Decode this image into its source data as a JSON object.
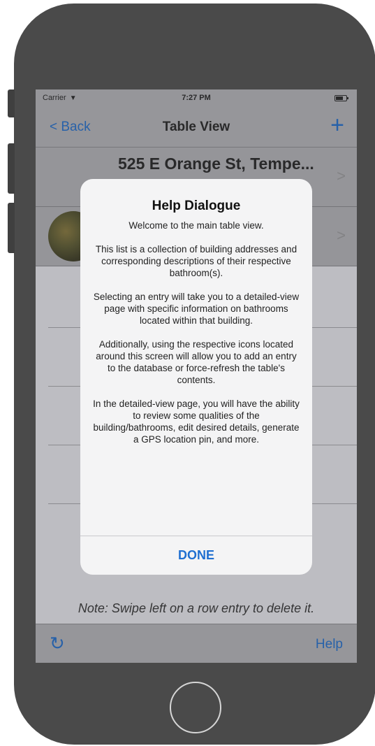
{
  "status": {
    "carrier": "Carrier",
    "time": "7:27 PM",
    "wifi_icon": "wifi-icon",
    "battery_icon": "battery-icon"
  },
  "nav": {
    "back_label": "< Back",
    "title": "Table View",
    "add_icon": "+"
  },
  "rows": [
    {
      "title": "525 E Orange St, Tempe...",
      "subtitle": "...",
      "chevron": ">"
    },
    {
      "title": "",
      "subtitle": "...",
      "chevron": ">"
    }
  ],
  "footer_note": "Note: Swipe left on a row entry to delete it.",
  "toolbar": {
    "refresh_icon": "↻",
    "help_label": "Help"
  },
  "alert": {
    "title": "Help Dialogue",
    "message": "Welcome to the main table view.\n\nThis list is a collection of building addresses and corresponding descriptions of their respective bathroom(s).\n\nSelecting an entry will take you to a detailed-view page with specific information on bathrooms located within that building.\n\nAdditionally, using the respective icons located around this screen will allow you to add an entry to the database or force-refresh the table's contents.\n\nIn the detailed-view page, you will have the ability to review some qualities of the building/bathrooms, edit desired details, generate a GPS location pin, and more.",
    "done_label": "DONE"
  },
  "colors": {
    "accent": "#1f6fd1",
    "bar_background": "#b9b9bd",
    "phone_body": "#4a4a4a"
  }
}
